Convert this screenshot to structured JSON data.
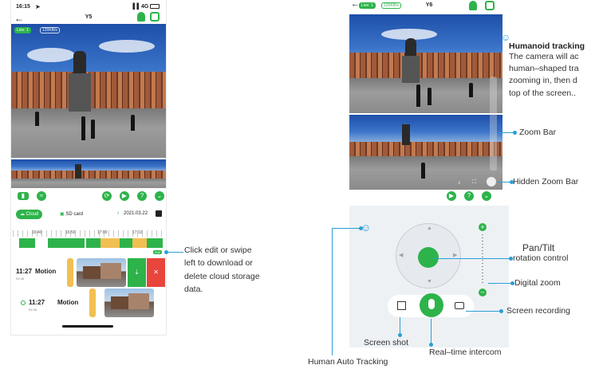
{
  "left_phone": {
    "status_time": "16:15",
    "status_network": "4G",
    "title": "Y5",
    "live_badge": "Live: 1",
    "speed_badge": "120KB/s",
    "tabs": {
      "cloud": "Cloud",
      "sd": "SD card"
    },
    "date": "2021.03.22",
    "timeline_labels": [
      "16:40",
      "16:50",
      "17:00",
      "17:10"
    ],
    "edit_label": "Edit",
    "events": [
      {
        "time": "11:27",
        "type": "Motion",
        "sub": "05:38"
      },
      {
        "time": "11:27",
        "type": "Motion",
        "sub": "05:38"
      }
    ]
  },
  "right_phone": {
    "title": "Y6",
    "live_badge": "Live: 1",
    "speed_badge": "120KB/s"
  },
  "annotations": {
    "edit_swipe": [
      "Click edit or swipe",
      "left to download or",
      "delete cloud storage",
      "data."
    ],
    "humanoid_title": "Humanoid tracking",
    "humanoid_lines": [
      "The camera will ac",
      "human–shaped tra",
      "zooming in, then d",
      "top of the screen.."
    ],
    "zoom_bar": "Zoom Bar",
    "hidden_zoom_bar": "Hidden Zoom Bar",
    "pan_tilt_1": "Pan/Tilt",
    "pan_tilt_2": "rotation control",
    "digital_zoom": "Digital zoom",
    "screen_recording": "Screen recording",
    "screen_shot": "Screen shot",
    "intercom": "Real–time intercom",
    "human_auto": "Human Auto Tracking"
  },
  "colors": {
    "accent": "#2db34a",
    "annotation": "#2a9fd6",
    "delete": "#e8453c",
    "event": "#f2bf52"
  }
}
